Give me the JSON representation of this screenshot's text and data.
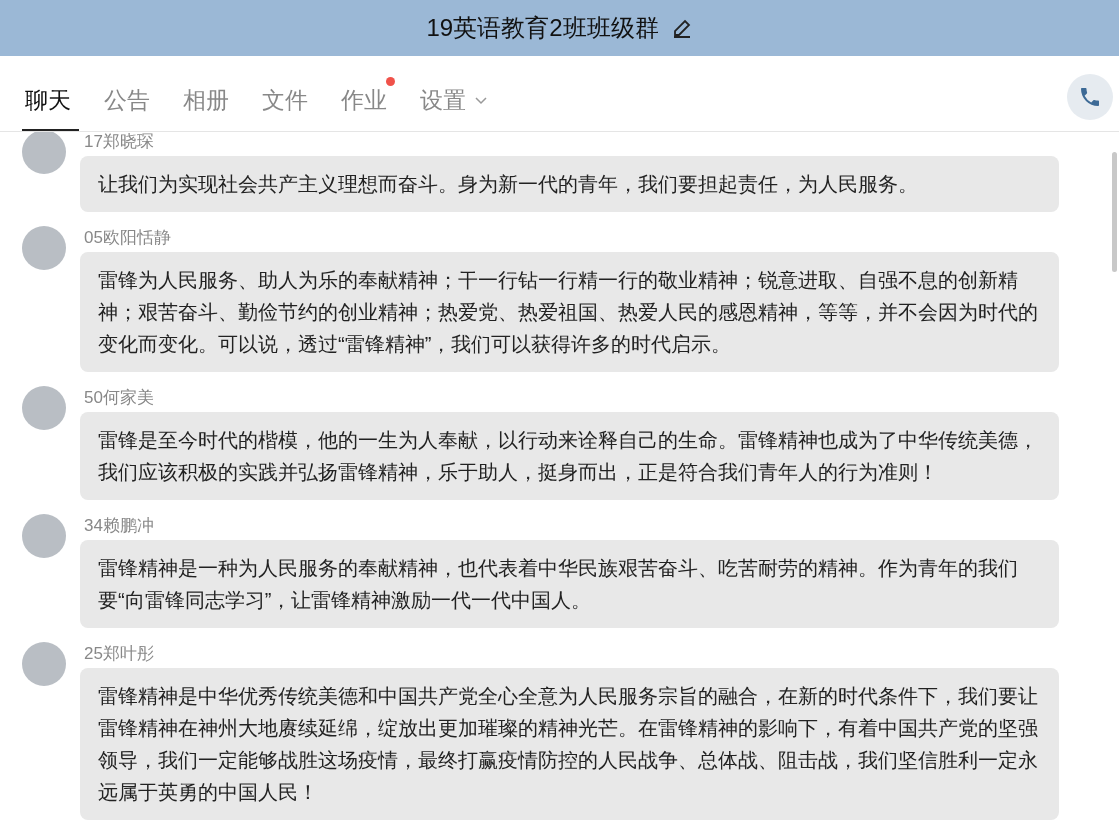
{
  "window": {
    "title": "19英语教育2班班级群"
  },
  "tabs": [
    {
      "label": "聊天",
      "selected": true,
      "badge": false,
      "dropdown": false
    },
    {
      "label": "公告",
      "selected": false,
      "badge": false,
      "dropdown": false
    },
    {
      "label": "相册",
      "selected": false,
      "badge": false,
      "dropdown": false
    },
    {
      "label": "文件",
      "selected": false,
      "badge": false,
      "dropdown": false
    },
    {
      "label": "作业",
      "selected": false,
      "badge": true,
      "dropdown": false
    },
    {
      "label": "设置",
      "selected": false,
      "badge": false,
      "dropdown": true
    }
  ],
  "messages": [
    {
      "sender": "17郑晓琛",
      "text": "让我们为实现社会共产主义理想而奋斗。身为新一代的青年，我们要担起责任，为人民服务。"
    },
    {
      "sender": "05欧阳恬静",
      "text": "雷锋为人民服务、助人为乐的奉献精神；干一行钻一行精一行的敬业精神；锐意进取、自强不息的创新精神；艰苦奋斗、勤俭节约的创业精神；热爱党、热爱祖国、热爱人民的感恩精神，等等，并不会因为时代的变化而变化。可以说，透过“雷锋精神”，我们可以获得许多的时代启示。"
    },
    {
      "sender": "50何家美",
      "text": "雷锋是至今时代的楷模，他的一生为人奉献，以行动来诠释自己的生命。雷锋精神也成为了中华传统美德，我们应该积极的实践并弘扬雷锋精神，乐于助人，挺身而出，正是符合我们青年人的行为准则！"
    },
    {
      "sender": "34赖鹏冲",
      "text": "雷锋精神是一种为人民服务的奉献精神，也代表着中华民族艰苦奋斗、吃苦耐劳的精神。作为青年的我们要“向雷锋同志学习”，让雷锋精神激励一代一代中国人。"
    },
    {
      "sender": "25郑叶彤",
      "text": "雷锋精神是中华优秀传统美德和中国共产党全心全意为人民服务宗旨的融合，在新的时代条件下，我们要让雷锋精神在神州大地赓续延绵，绽放出更加璀璨的精神光芒。在雷锋精神的影响下，有着中国共产党的坚强领导，我们一定能够战胜这场疫情，最终打赢疫情防控的人民战争、总体战、阻击战，我们坚信胜利一定永远属于英勇的中国人民！"
    }
  ]
}
